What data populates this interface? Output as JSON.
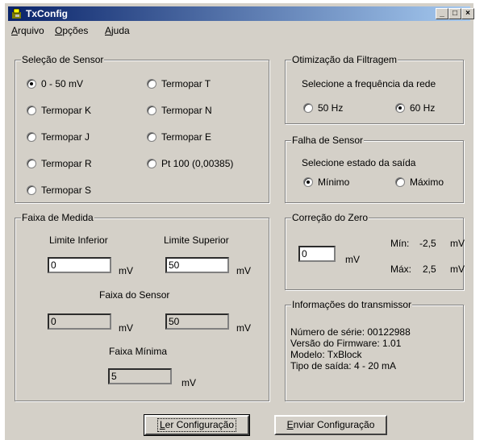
{
  "window": {
    "title": "TxConfig",
    "minimize": "_",
    "maximize": "□",
    "close": "×"
  },
  "menu": [
    {
      "accel": "A",
      "rest": "rquivo"
    },
    {
      "accel": "O",
      "rest": "pções"
    },
    {
      "accel": "A",
      "rest": "juda"
    }
  ],
  "sensor": {
    "title": "Seleção de Sensor",
    "options": [
      "0 - 50 mV",
      "Termopar K",
      "Termopar J",
      "Termopar R",
      "Termopar S",
      "Termopar T",
      "Termopar N",
      "Termopar E",
      "Pt 100 (0,00385)"
    ],
    "selected": "0 - 50 mV"
  },
  "faixa": {
    "title": "Faixa de Medida",
    "limite_inferior_label": "Limite Inferior",
    "limite_superior_label": "Limite Superior",
    "limite_inferior": "0",
    "limite_superior": "50",
    "unit": "mV",
    "faixa_sensor_label": "Faixa do Sensor",
    "sensor_min": "0",
    "sensor_max": "50",
    "faixa_minima_label": "Faixa Mínima",
    "faixa_minima": "5"
  },
  "filtro": {
    "title": "Otimização da Filtragem",
    "prompt": "Selecione a frequência da rede",
    "opt1": "50 Hz",
    "opt2": "60 Hz",
    "selected": "60 Hz"
  },
  "falha": {
    "title": "Falha de Sensor",
    "prompt": "Selecione estado da saída",
    "opt1": "Mínimo",
    "opt2": "Máximo",
    "selected": "Mínimo"
  },
  "zero": {
    "title": "Correção do Zero",
    "value": "0",
    "unit": "mV",
    "min_label": "Mín:",
    "min_value": "-2,5",
    "max_label": "Máx:",
    "max_value": "2,5",
    "range_unit": "mV"
  },
  "info": {
    "title": "Informações do transmissor",
    "lines": [
      "Número de série: 00122988",
      "Versão do Firmware: 1.01",
      "Modelo: TxBlock",
      "Tipo de saída: 4 - 20 mA"
    ]
  },
  "buttons": {
    "ler": {
      "accel": "L",
      "rest": "er Configuração"
    },
    "enviar": {
      "accel": "E",
      "rest": "nviar Configuração"
    }
  }
}
